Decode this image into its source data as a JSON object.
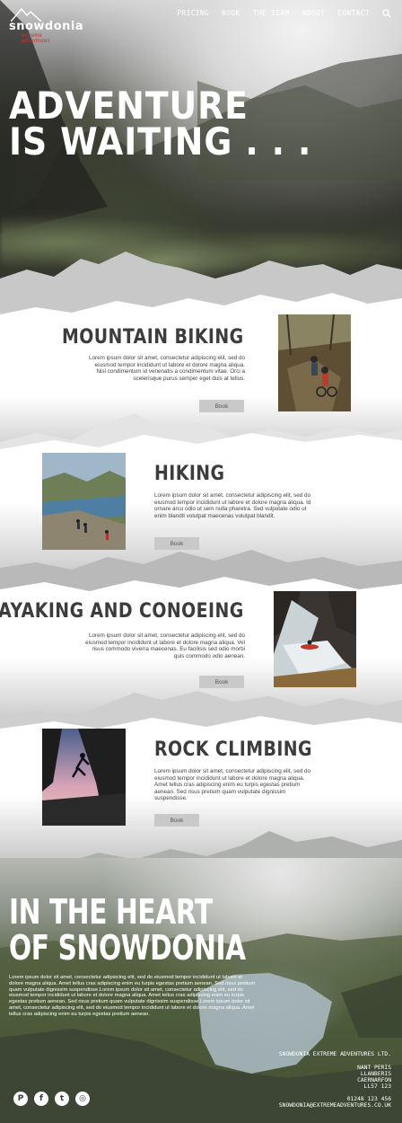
{
  "brand": {
    "name": "snowdonia",
    "tagline": "extreme adventures"
  },
  "nav": {
    "items": [
      "PRICING",
      "BOOK",
      "THE TEAM",
      "ABOUT",
      "CONTACT"
    ],
    "search_icon": "search-icon"
  },
  "hero": {
    "title_line1": "ADVENTURE",
    "title_line2": "IS WAITING . . ."
  },
  "sections": [
    {
      "title": "MOUNTAIN BIKING",
      "text": "Lorem ipsum dolor sit amet, consectetur adipiscing elit, sed do eiusmod tempor incididunt ut labore et dolore magna aliqua. Nisl condimentum id venenatis a condimentum vitae. Orci a scelerisque purus semper eget duis at tellus.",
      "button": "Book"
    },
    {
      "title": "HIKING",
      "text": "Lorem ipsum dolor sit amet, consectetur adipiscing elit, sed do eiusmod tempor incididunt ut labore et dolore magna aliqua. Id ornare arcu odio ut sem nulla pharetra. Sed vulputate odio ut enim blandit volutpat maecenas volutpat blandit.",
      "button": "Book"
    },
    {
      "title": "KAYAKING AND CONOEING",
      "text": "Lorem ipsum dolor sit amet, consectetur adipiscing elit, sed do eiusmod tempor incididunt ut labore et dolore magna aliqua. Vel risus commodo viverra maecenas. Eu facilisis sed odio morbi quis commodo odio aenean.",
      "button": "Book"
    },
    {
      "title": "ROCK CLIMBING",
      "text": "Lorem ipsum dolor sit amet, consectetur adipiscing elit, sed do eiusmod tempor incididunt ut labore et dolore magna aliqua. Amet tellus cras adipiscing enim eu turpis egestas pretium aenean. Sed risus pretium quam vulputate dignissim suspendisse.",
      "button": "Book"
    }
  ],
  "footer": {
    "title_line1": "IN THE HEART",
    "title_line2": "OF SNOWDONIA",
    "text": "Lorem ipsum dolor sit amet, consectetur adipiscing elit, sed do eiusmod tempor incididunt ut labore et dolore magna aliqua. Amet tellus cras adipiscing enim eu turpis egestas pretium aenean. Sed risus pretium quam vulputate dignissim suspendisse.Lorem ipsum dolor sit amet, consectetur adipiscing elit, sed do eiusmod tempor incididunt ut labore et dolore magna aliqua. Amet tellus cras adipiscing enim eu turpis egestas pretium aenean. Sed risus pretium quam vulputate dignissim suspendisse.Lorem ipsum dolor sit amet, consectetur adipiscing elit, sed do eiusmod tempor incididunt ut labore et dolore magna aliqua. Amet tellus cras adipiscing enim eu turpis egestas pretium aenean.",
    "company": "SNOWDONIA EXTREME ADVENTURES LTD.",
    "address_lines": [
      "NANT PERIS",
      "LLANBERIS",
      "CAERNARFON",
      "LL57 123"
    ],
    "phone": "01248 123 456",
    "email": "SNOWDONIA@EXTREMEADVENTURES.CO.UK",
    "socials": [
      {
        "name": "pinterest-icon",
        "glyph": "P"
      },
      {
        "name": "facebook-icon",
        "glyph": "f"
      },
      {
        "name": "twitter-icon",
        "glyph": "t"
      },
      {
        "name": "instagram-icon",
        "glyph": "◎"
      }
    ]
  }
}
